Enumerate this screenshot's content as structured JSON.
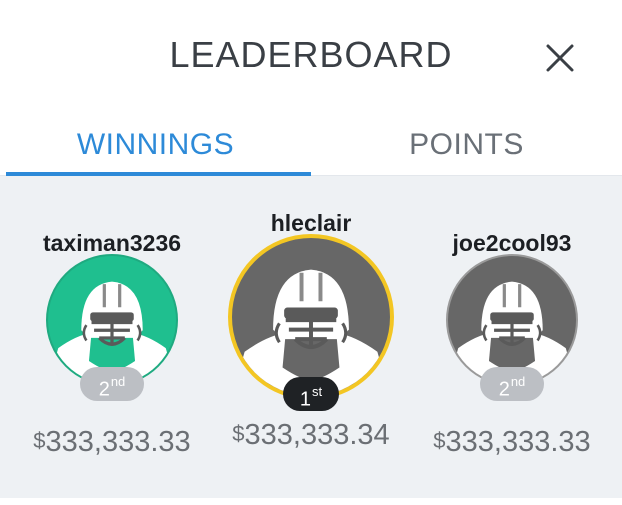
{
  "header": {
    "title": "LEADERBOARD",
    "close_icon": "close-icon"
  },
  "tabs": [
    {
      "label": "WINNINGS",
      "active": true
    },
    {
      "label": "POINTS",
      "active": false
    }
  ],
  "colors": {
    "accent": "#2d8ad8",
    "first_place_ring": "#f3c623",
    "teal_avatar": "#1fbf8f",
    "gray_avatar": "#676767",
    "panel_bg": "#eef1f4"
  },
  "players": [
    {
      "username": "taximan3236",
      "rank_number": "2",
      "rank_suffix": "nd",
      "currency": "$",
      "winnings": "333,333.33",
      "avatar_icon": "football-player-avatar-icon"
    },
    {
      "username": "hleclair",
      "rank_number": "1",
      "rank_suffix": "st",
      "currency": "$",
      "winnings": "333,333.34",
      "avatar_icon": "football-player-avatar-icon"
    },
    {
      "username": "joe2cool93",
      "rank_number": "2",
      "rank_suffix": "nd",
      "currency": "$",
      "winnings": "333,333.33",
      "avatar_icon": "football-player-avatar-icon"
    }
  ]
}
